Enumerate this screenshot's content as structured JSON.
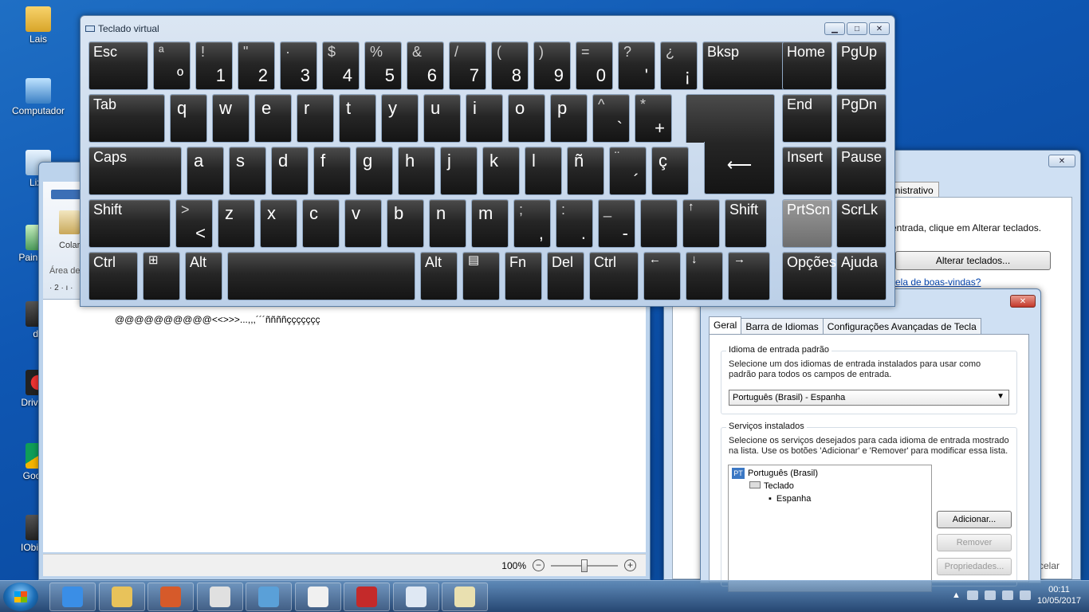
{
  "desktop": {
    "icons": [
      {
        "label": "Lais",
        "icon": "folder-icon"
      },
      {
        "label": "Computador",
        "icon": "computer-icon"
      },
      {
        "label": "Lixe",
        "icon": "recycle-bin-icon"
      },
      {
        "label": "Pain Con",
        "icon": "control-panel-icon"
      },
      {
        "label": "de",
        "icon": "app-icon"
      },
      {
        "label": "Driver B",
        "icon": "driver-booster-icon"
      },
      {
        "label": "Google",
        "icon": "chrome-icon"
      },
      {
        "label": "IObit Un",
        "icon": "iobit-icon"
      }
    ]
  },
  "wordpad": {
    "ribbon_paste": "Colar",
    "ribbon_area": "Área de",
    "ruler": "· 2 · ı ·",
    "document_text": "@@@@@@@@@@<<>>>...,,,´´´ññññççççççç",
    "zoom": "100%",
    "zoom_minus": "−",
    "zoom_plus": "+"
  },
  "regional": {
    "tab_admin": "inistrativo",
    "hint": "entrada, clique em Alterar teclados.",
    "alterar_button": "Alterar teclados...",
    "link": "ela de boas-vindas?",
    "cancel": "celar"
  },
  "text_services": {
    "tabs": [
      "Geral",
      "Barra de Idiomas",
      "Configurações Avançadas de Tecla"
    ],
    "default_group_title": "Idioma de entrada padrão",
    "default_group_text": "Selecione um dos idiomas de entrada instalados para usar como padrão para todos os campos de entrada.",
    "default_select": "Português (Brasil) - Espanha",
    "services_group_title": "Serviços instalados",
    "services_group_text": "Selecione os serviços desejados para cada idioma de entrada mostrado na lista. Use os botões 'Adicionar' e 'Remover' para modificar essa lista.",
    "tree": {
      "language_badge": "PT",
      "language": "Português (Brasil)",
      "keyboard": "Teclado",
      "layout": "Espanha"
    },
    "buttons": {
      "add": "Adicionar...",
      "remove": "Remover",
      "properties": "Propriedades..."
    }
  },
  "osk": {
    "title": "Teclado virtual",
    "rows": [
      [
        {
          "label": "Esc",
          "w": 1
        },
        {
          "sup": "ª",
          "main": "º"
        },
        {
          "sup": "!",
          "main": "1"
        },
        {
          "sup": "\"",
          "main": "2"
        },
        {
          "sup": "·",
          "main": "3"
        },
        {
          "sup": "$",
          "main": "4"
        },
        {
          "sup": "%",
          "main": "5"
        },
        {
          "sup": "&",
          "main": "6"
        },
        {
          "sup": "/",
          "main": "7"
        },
        {
          "sup": "(",
          "main": "8"
        },
        {
          "sup": ")",
          "main": "9"
        },
        {
          "sup": "=",
          "main": "0"
        },
        {
          "sup": "?",
          "main": "'"
        },
        {
          "sup": "¿",
          "main": "¡"
        },
        {
          "label": "Bksp"
        }
      ],
      [
        {
          "label": "Tab"
        },
        {
          "main": "q"
        },
        {
          "main": "w"
        },
        {
          "main": "e"
        },
        {
          "main": "r"
        },
        {
          "main": "t"
        },
        {
          "main": "y"
        },
        {
          "main": "u"
        },
        {
          "main": "i"
        },
        {
          "main": "o"
        },
        {
          "main": "p"
        },
        {
          "sup": "^",
          "main": "`"
        },
        {
          "sup": "*",
          "main": "+"
        }
      ],
      [
        {
          "label": "Caps"
        },
        {
          "main": "a"
        },
        {
          "main": "s"
        },
        {
          "main": "d"
        },
        {
          "main": "f"
        },
        {
          "main": "g"
        },
        {
          "main": "h"
        },
        {
          "main": "j"
        },
        {
          "main": "k"
        },
        {
          "main": "l"
        },
        {
          "main": "ñ"
        },
        {
          "sup": "¨",
          "main": "´"
        },
        {
          "main": "ç"
        }
      ],
      [
        {
          "label": "Shift"
        },
        {
          "sup": ">",
          "main": "<"
        },
        {
          "main": "z"
        },
        {
          "main": "x"
        },
        {
          "main": "c"
        },
        {
          "main": "v"
        },
        {
          "main": "b"
        },
        {
          "main": "n"
        },
        {
          "main": "m"
        },
        {
          "sup": ";",
          "main": ","
        },
        {
          "sup": ":",
          "main": "."
        },
        {
          "sup": "_",
          "main": "-"
        },
        {
          "main": ""
        },
        {
          "arrow": "↑"
        },
        {
          "label": "Shift"
        }
      ],
      [
        {
          "label": "Ctrl"
        },
        {
          "icon": "windows-icon"
        },
        {
          "label": "Alt"
        },
        {
          "label": ""
        },
        {
          "label": "Alt"
        },
        {
          "icon": "menu-icon"
        },
        {
          "label": "Fn"
        },
        {
          "label": "Del"
        },
        {
          "label": "Ctrl"
        },
        {
          "arrow": "←"
        },
        {
          "arrow": "↓"
        },
        {
          "arrow": "→"
        }
      ]
    ],
    "enter": "⟵",
    "nav": [
      [
        "Home",
        "PgUp"
      ],
      [
        "End",
        "PgDn"
      ],
      [
        "Insert",
        "Pause"
      ],
      [
        "PrtScn",
        "ScrLk"
      ],
      [
        "Opções",
        "Ajuda"
      ]
    ]
  },
  "taskbar": {
    "apps": [
      "internet-explorer-icon",
      "file-explorer-icon",
      "media-player-icon",
      "chrome-icon",
      "network-icon",
      "wordpad-icon",
      "driver-booster-icon",
      "keyboard-settings-icon",
      "on-screen-keyboard-icon"
    ],
    "time": "00:11",
    "date": "10/05/2017"
  }
}
